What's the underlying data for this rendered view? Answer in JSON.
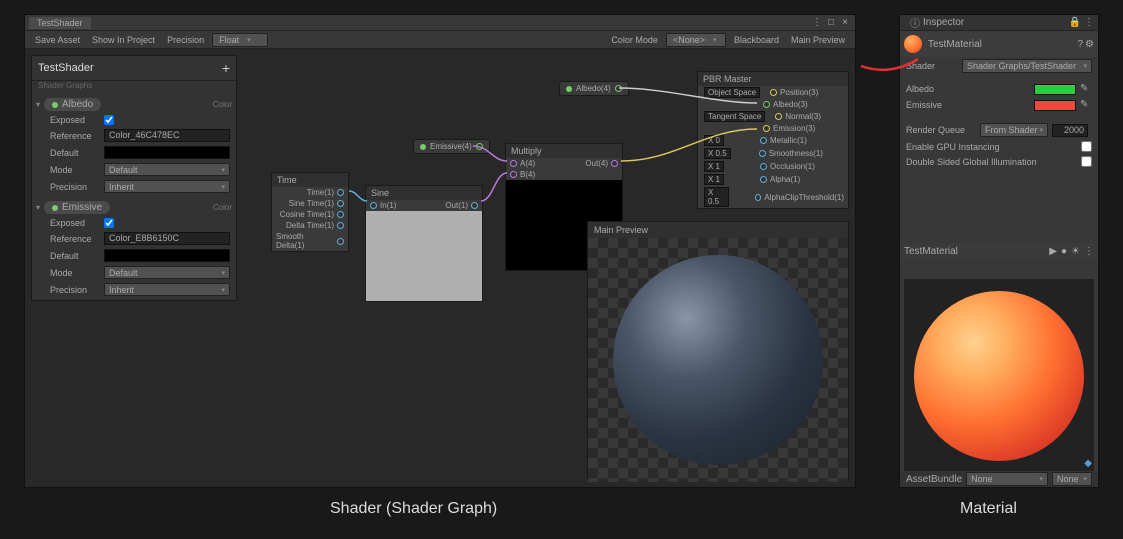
{
  "shader_window": {
    "tab": "TestShader",
    "toolbar": {
      "save": "Save Asset",
      "show": "Show In Project",
      "precision_label": "Precision",
      "precision_value": "Float",
      "color_mode_label": "Color Mode",
      "color_mode_value": "<None>",
      "blackboard": "Blackboard",
      "main_preview": "Main Preview"
    }
  },
  "blackboard": {
    "title": "TestShader",
    "subtitle": "Shader Graphs",
    "props": [
      {
        "name": "Albedo",
        "type": "Color",
        "exposed_label": "Exposed",
        "exposed": true,
        "reference_label": "Reference",
        "reference": "Color_46C478EC",
        "default_label": "Default",
        "mode_label": "Mode",
        "mode": "Default",
        "precision_label": "Precision",
        "precision": "Inherit"
      },
      {
        "name": "Emissive",
        "type": "Color",
        "exposed_label": "Exposed",
        "exposed": true,
        "reference_label": "Reference",
        "reference": "Color_E8B6150C",
        "default_label": "Default",
        "mode_label": "Mode",
        "mode": "Default",
        "precision_label": "Precision",
        "precision": "Inherit"
      }
    ]
  },
  "nodes": {
    "time": {
      "title": "Time",
      "out": [
        "Time(1)",
        "Sine Time(1)",
        "Cosine Time(1)",
        "Delta Time(1)",
        "Smooth Delta(1)"
      ]
    },
    "sine": {
      "title": "Sine",
      "in": "In(1)",
      "out": "Out(1)"
    },
    "multiply": {
      "title": "Multiply",
      "inA": "A(4)",
      "inB": "B(4)",
      "out": "Out(4)"
    },
    "albedo_prop": "Albedo(4)",
    "emissive_prop": "Emissive(4)",
    "master": {
      "title": "PBR Master",
      "spaces": [
        "Object Space",
        "",
        "Object Space",
        "Tangent Space"
      ],
      "ports": [
        "Position(3)",
        "Albedo(3)",
        "Normal(3)",
        "Emission(3)",
        "Metallic(1)",
        "Smoothness(1)",
        "Occlusion(1)",
        "Alpha(1)",
        "AlphaClipThreshold(1)"
      ],
      "vals": [
        "",
        "",
        "",
        "",
        "X  0",
        "X  0.5",
        "X  1",
        "X  1",
        "X  0.5"
      ]
    }
  },
  "main_preview": "Main Preview",
  "inspector": {
    "tab": "Inspector",
    "name": "TestMaterial",
    "shader_label": "Shader",
    "shader_value": "Shader Graphs/TestShader",
    "albedo": "Albedo",
    "emissive": "Emissive",
    "render_queue": "Render Queue",
    "render_queue_mode": "From Shader",
    "render_queue_val": "2000",
    "gpu": "Enable GPU Instancing",
    "dsgi": "Double Sided Global Illumination",
    "preview_name": "TestMaterial",
    "assetbundle": "AssetBundle",
    "ab_none": "None",
    "ab_none2": "None"
  },
  "captions": {
    "left": "Shader (Shader Graph)",
    "right": "Material"
  }
}
